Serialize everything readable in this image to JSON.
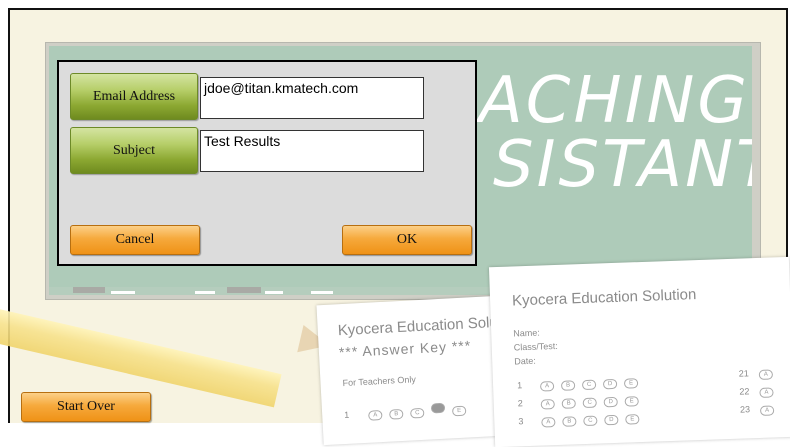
{
  "dialog": {
    "email_label": "Email Address",
    "email_value": "jdoe@titan.kmatech.com",
    "subject_label": "Subject",
    "subject_value": "Test Results",
    "cancel_label": "Cancel",
    "ok_label": "OK"
  },
  "board": {
    "line1": "ACHING",
    "line2": "SISTANT"
  },
  "sheets": {
    "back_title": "Kyocera Education Solut",
    "back_subtitle": "*** Answer Key ***",
    "back_note": "For Teachers Only",
    "back_row_number": "1",
    "front_title": "Kyocera Education Solution",
    "front_name_label": "Name:",
    "front_class_label": "Class/Test:",
    "front_date_label": "Date:",
    "front_rows": [
      "1",
      "2",
      "3"
    ],
    "front_rows_right": [
      "21",
      "22",
      "23"
    ],
    "bubble_letters": [
      "A",
      "B",
      "C",
      "D",
      "E"
    ]
  },
  "footer": {
    "start_over_label": "Start Over"
  },
  "colors": {
    "chalkboard": "#aecbb9",
    "button_green": "#8ca832",
    "button_orange": "#f6a93c",
    "dialog_bg": "#dcdcdc"
  }
}
